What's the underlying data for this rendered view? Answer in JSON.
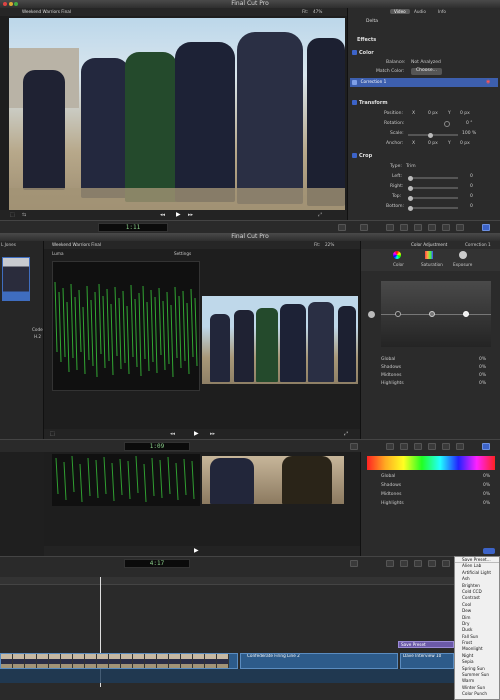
{
  "top_window": {
    "title": "Final Cut Pro",
    "viewer_title": "Weekend Warriors Final",
    "fit_label": "Fit:",
    "zoom": "47%",
    "timecode": "1:11"
  },
  "inspector": {
    "tabs": [
      "Video",
      "Audio",
      "Info"
    ],
    "clip_name": "Delta",
    "effects_label": "Effects",
    "color": {
      "label": "Color",
      "balance_label": "Balance:",
      "balance_value": "Not Analyzed",
      "match_label": "Match Color:",
      "match_button": "Choose...",
      "correction": "Correction 1"
    },
    "transform": {
      "label": "Transform",
      "rows": [
        {
          "label": "Position:",
          "x_label": "X",
          "x": "0 px",
          "y_label": "Y",
          "y": "0 px"
        },
        {
          "label": "Rotation:",
          "value": "0 °"
        },
        {
          "label": "Scale:",
          "value": "100 %"
        },
        {
          "label": "Anchor:",
          "x_label": "X",
          "x": "0 px",
          "y_label": "Y",
          "y": "0 px"
        }
      ]
    },
    "crop": {
      "label": "Crop",
      "type_label": "Type:",
      "type_value": "Trim",
      "rows": [
        {
          "label": "Left:",
          "value": "0"
        },
        {
          "label": "Right:",
          "value": "0"
        },
        {
          "label": "Top:",
          "value": "0"
        },
        {
          "label": "Bottom:",
          "value": "0"
        }
      ]
    }
  },
  "middle_window": {
    "title": "Final Cut Pro",
    "viewer_title": "Weekend Warriors Final",
    "fit_label": "Fit:",
    "zoom": "22%",
    "scope_label": "Luma",
    "settings_label": "Settings",
    "timecode": "1:09",
    "side_label": "Code",
    "side_value": "H.2",
    "browser_label": "L Jones"
  },
  "color_board": {
    "title": "Color Adjustment",
    "correction": "Correction 1",
    "tabs": [
      "Color",
      "Saturation",
      "Exposure"
    ],
    "ranges": [
      {
        "label": "Global",
        "value": "0%"
      },
      {
        "label": "Shadows",
        "value": "0%"
      },
      {
        "label": "Midtones",
        "value": "0%"
      },
      {
        "label": "Highlights",
        "value": "0%"
      }
    ],
    "ranges2": [
      {
        "label": "Global",
        "value": "0%"
      },
      {
        "label": "Shadows",
        "value": "0%"
      },
      {
        "label": "Midtones",
        "value": "0%"
      },
      {
        "label": "Highlights",
        "value": "0%"
      }
    ]
  },
  "timeline": {
    "timecode": "4:17",
    "clips": [
      {
        "label": "Confederate Firing Line 2"
      },
      {
        "label": "Dave Interview 10"
      },
      {
        "label": "Save Preset"
      }
    ]
  },
  "preset_menu": {
    "items": [
      "Save Preset...",
      "Alien Lab",
      "Artificial Light",
      "Ash",
      "Brighten",
      "Cold CCD",
      "Contrast",
      "Cool",
      "Dew",
      "Dim",
      "Dry",
      "Dusk",
      "Fall Sun",
      "Frost",
      "Moonlight",
      "Night",
      "Sepia",
      "Spring Sun",
      "Summer Sun",
      "Warm",
      "Winter Sun",
      "Color Punch"
    ]
  },
  "colors": {
    "accent": "#3c63c8",
    "scope_green": "#38c23a",
    "clip_blue": "#2d5b8a",
    "clip_purple": "#6b5aa8"
  }
}
